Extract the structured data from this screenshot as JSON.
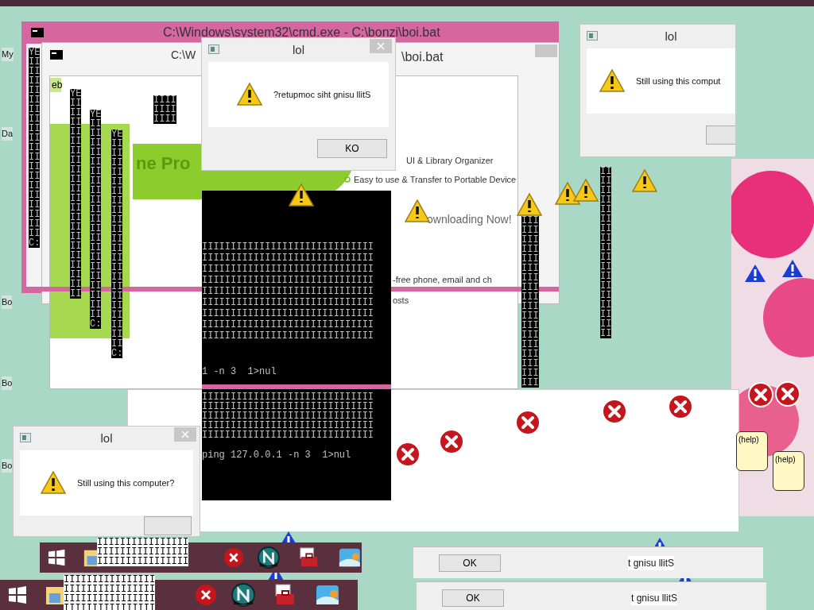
{
  "desktop_icons": [
    {
      "label": "My"
    },
    {
      "label": "Da"
    },
    {
      "label": "Bo"
    },
    {
      "label": "Bo"
    },
    {
      "label": "Bo"
    }
  ],
  "cmd_windows": [
    {
      "title": "C:\\Windows\\system32\\cmd.exe - C:\\bonzi\\boi.bat"
    },
    {
      "title": "C:\\W",
      "title_end": "\\boi.bat"
    }
  ],
  "cmd_columns": [
    {
      "text": "YE\nII\nII\nII\nII\nII\nII\nII\nII\nII\nII\nII\nII\nII\nII\nII\nII\nII\nII\nII\nC:"
    },
    {
      "text": "YE\nII\nII\nII\nII\nII\nII\nII\nII\nII\nII\nII\nII\nII\nII\nII\nII\nII\nII\nII\nII\nII"
    },
    {
      "text": "YE\nII\nII\nII\nII\nII\nII\nII\nII\nII\nII\nII\nII\nII\nII\nII\nII\nII\nII\nII\nII\nII\nC:"
    },
    {
      "text": "YE\nII\nII\nII\nII\nII\nII\nII\nII\nII\nII\nII\nII\nII\nII\nII\nII\nII\nII\nII\nII\nII\nII\nC:"
    },
    {
      "text": "IIII\nIIII\nIIII"
    },
    {
      "text": "III\nIII\nIII\nIII\nIII\nIII\nIII\nIII\nIII\nIII\nIII\nIII\nIII\nIII\nIII\nIII\nIII\nIII"
    },
    {
      "text": "II\nII\nII\nII\nII\nII\nII\nII\nII\nII\nII\nII\nII\nII\nII\nII\nII\nII"
    }
  ],
  "ad": {
    "tab": "eb",
    "brand": "ne Pro",
    "features": [
      "UI & Library Organizer",
      "Easy to use & Transfer to Portable Device"
    ],
    "headline": "ownloading Now!",
    "line_1": "-free phone, email and ch",
    "line_2": "osts"
  },
  "console": {
    "grid": "IIIIIIIIIIIIIIIIIIIIIIIIIIIIII\nIIIIIIIIIIIIIIIIIIIIIIIIIIIIII\nIIIIIIIIIIIIIIIIIIIIIIIIIIIIII\nIIIIIIIIIIIIIIIIIIIIIIIIIIIIII\nIIIIIIIIIIIIIIIIIIIIIIIIIIIIII\nIIIIIIIIIIIIIIIIIIIIIIIIIIIIII\nIIIIIIIIIIIIIIIIIIIIIIIIIIIIII\nIIIIIIIIIIIIIIIIIIIIIIIIIIIIII\nIIIIIIIIIIIIIIIIIIIIIIIIIIIIII",
    "line_1": "1 -n 3  1>nul",
    "grid_2": "IIIIIIIIIIIIIIIIIIIIIIIIIIIIII\nIIIIIIIIIIIIIIIIIIIIIIIIIIIIII\nIIIIIIIIIIIIIIIIIIIIIIIIIIIIII\nIIIIIIIIIIIIIIIIIIIIIIIIIIIIII\nIIIIIIIIIIIIIIIIIIIIIIIIIIIIII",
    "line_2": "ping 127.0.0.1 -n 3  1>nul"
  },
  "dialogs": [
    {
      "title": "lol",
      "message": "?retupmoc siht gnisu llitS",
      "button": "KO"
    },
    {
      "title": "lol",
      "message": "Still using this comput"
    },
    {
      "title": "lol",
      "message": "Still using this computer?"
    }
  ],
  "help_bubbles": [
    "(help)",
    "(help)"
  ],
  "bottom_dialogs": [
    {
      "message": "t gnisu llitS",
      "button": "OK"
    },
    {
      "message": "t gnisu llitS",
      "button": "OK"
    }
  ],
  "taskbar_grids": [
    "IIIIIIIIIIIIIIII\nIIIIIIIIIIIIIIII\nIIIIIIIIIIIIIIII",
    "IIIIIIIIIIIIIIII\nIIIIIIIIIIIIIIII\nIIIIIIIIIIIIIIII\nIIIIIIIIIIIIIIII"
  ]
}
